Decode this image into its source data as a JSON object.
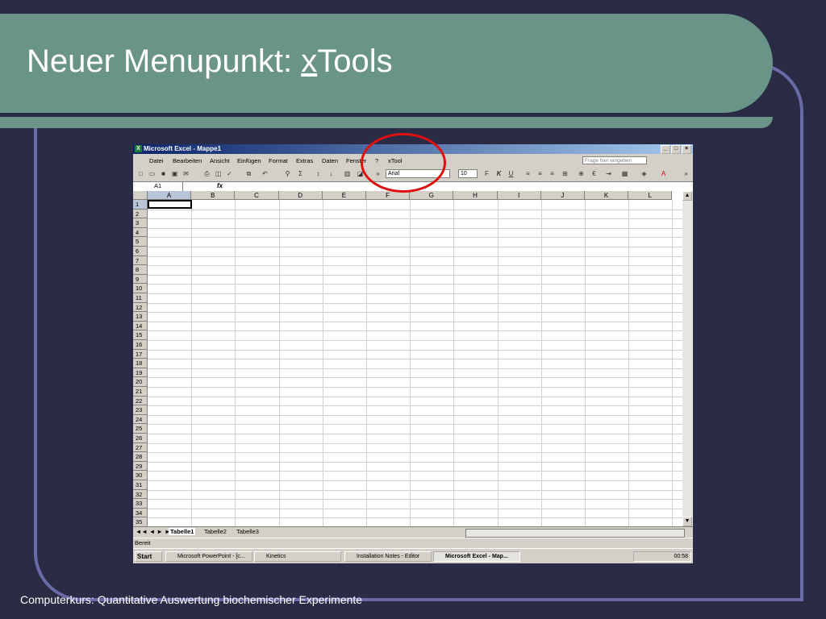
{
  "slide": {
    "title_prefix": "Neuer Menupunkt: ",
    "title_underlined": "x",
    "title_rest": "Tools",
    "footer": "Computerkurs: Quantitative Auswertung biochemischer Experimente"
  },
  "excel": {
    "window_title": "Microsoft Excel - Mappe1",
    "menu": [
      "Datei",
      "Bearbeiten",
      "Ansicht",
      "Einfügen",
      "Format",
      "Extras",
      "Daten",
      "Fenster",
      "?",
      "xTool"
    ],
    "ask_placeholder": "Frage hier eingeben",
    "font": "Arial",
    "font_size": "10",
    "name_box": "A1",
    "fx": "fx",
    "columns": [
      "A",
      "B",
      "C",
      "D",
      "E",
      "F",
      "G",
      "H",
      "I",
      "J",
      "K",
      "L"
    ],
    "rows": [
      "1",
      "2",
      "3",
      "4",
      "5",
      "6",
      "7",
      "8",
      "9",
      "10",
      "11",
      "12",
      "13",
      "14",
      "15",
      "16",
      "17",
      "18",
      "19",
      "20",
      "21",
      "22",
      "23",
      "24",
      "25",
      "26",
      "27",
      "28",
      "29",
      "30",
      "31",
      "32",
      "33",
      "34",
      "35"
    ],
    "sheet_tabs": [
      "Tabelle1",
      "Tabelle2",
      "Tabelle3"
    ],
    "status": "Bereit"
  },
  "taskbar": {
    "start": "Start",
    "items": [
      "Microsoft PowerPoint - [c...",
      "Kinetics",
      "Installation Notes - Editor",
      "Microsoft Excel - Map..."
    ],
    "clock": "00:58"
  },
  "colors": {
    "title_bg": "#6a9488",
    "page_bg": "#2a2c45",
    "frame": "#6a6aa8",
    "highlight": "#e01010"
  }
}
